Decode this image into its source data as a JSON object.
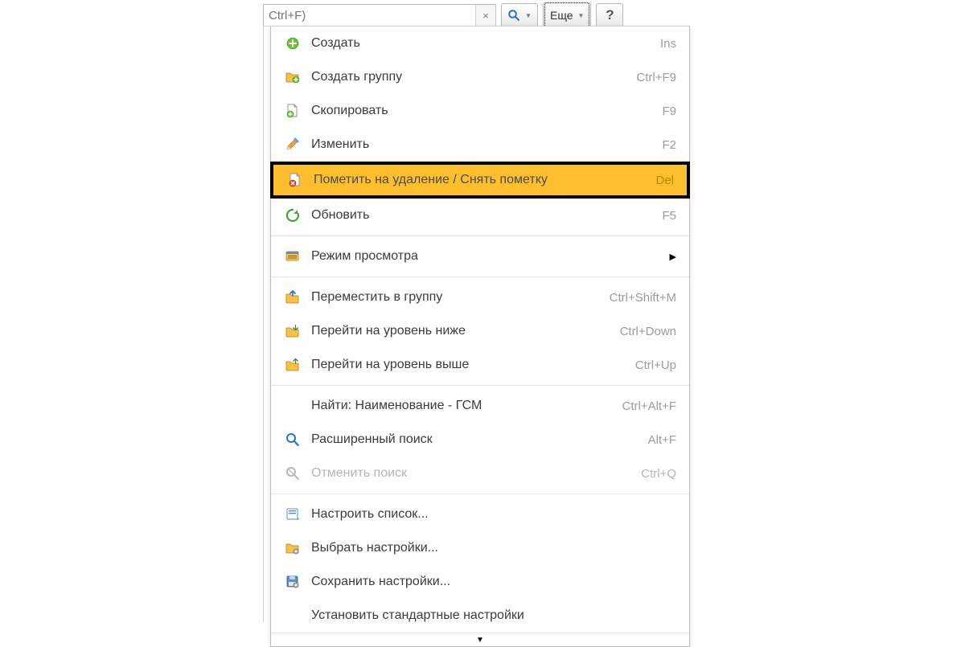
{
  "toolbar": {
    "search_placeholder": "Ctrl+F)",
    "clear_glyph": "×",
    "more_label": "Еще",
    "help_label": "?"
  },
  "menu": {
    "items": [
      {
        "label": "Создать",
        "shortcut": "Ins",
        "icon": "plus-circle",
        "type": "item"
      },
      {
        "label": "Создать группу",
        "shortcut": "Ctrl+F9",
        "icon": "folder-plus",
        "type": "item"
      },
      {
        "label": "Скопировать",
        "shortcut": "F9",
        "icon": "page-plus",
        "type": "item"
      },
      {
        "label": "Изменить",
        "shortcut": "F2",
        "icon": "pencil",
        "type": "item"
      },
      {
        "label": "Пометить на удаление / Снять пометку",
        "shortcut": "Del",
        "icon": "page-delete",
        "type": "highlight"
      },
      {
        "label": "Обновить",
        "shortcut": "F5",
        "icon": "refresh",
        "type": "item"
      },
      {
        "type": "sep"
      },
      {
        "label": "Режим просмотра",
        "shortcut": "",
        "icon": "view-mode",
        "type": "submenu"
      },
      {
        "type": "sep"
      },
      {
        "label": "Переместить в группу",
        "shortcut": "Ctrl+Shift+M",
        "icon": "folder-move",
        "type": "item"
      },
      {
        "label": "Перейти на уровень ниже",
        "shortcut": "Ctrl+Down",
        "icon": "folder-down",
        "type": "item"
      },
      {
        "label": "Перейти на уровень выше",
        "shortcut": "Ctrl+Up",
        "icon": "folder-up",
        "type": "item"
      },
      {
        "type": "sep"
      },
      {
        "label": "Найти: Наименование - ГСМ",
        "shortcut": "Ctrl+Alt+F",
        "icon": "",
        "type": "item"
      },
      {
        "label": "Расширенный поиск",
        "shortcut": "Alt+F",
        "icon": "search-adv",
        "type": "item"
      },
      {
        "label": "Отменить поиск",
        "shortcut": "Ctrl+Q",
        "icon": "search-cancel",
        "type": "disabled"
      },
      {
        "type": "sep"
      },
      {
        "label": "Настроить список...",
        "shortcut": "",
        "icon": "list-settings",
        "type": "item"
      },
      {
        "label": "Выбрать настройки...",
        "shortcut": "",
        "icon": "folder-gear",
        "type": "item"
      },
      {
        "label": "Сохранить настройки...",
        "shortcut": "",
        "icon": "disk-gear",
        "type": "item"
      },
      {
        "label": "Установить стандартные настройки",
        "shortcut": "",
        "icon": "",
        "type": "item"
      }
    ],
    "more_glyph": "▼"
  }
}
